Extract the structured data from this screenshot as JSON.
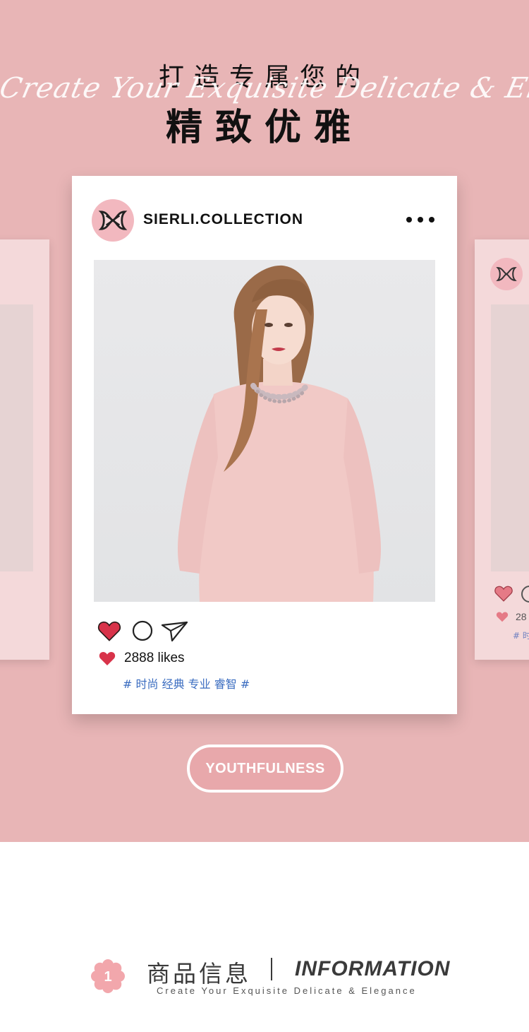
{
  "header": {
    "title_line1": "打造专属您的",
    "title_line2": "精致优雅",
    "script_text": "Create Your Exquisite Delicate & Elegance"
  },
  "post": {
    "handle": "SIERLI.COLLECTION",
    "likes_text": "2888 likes",
    "tags": "# 时尚 经典 专业 睿智 #",
    "icons": [
      "more-icon",
      "heart-icon",
      "comment-icon",
      "share-icon"
    ]
  },
  "side_card_right": {
    "likes_text": "28",
    "tags": "# 时"
  },
  "badge": {
    "label": "YOUTHFULNESS"
  },
  "info": {
    "number": "1",
    "cn": "商品信息",
    "en": "INFORMATION",
    "sub": "Create Your Exquisite Delicate & Elegance"
  },
  "colors": {
    "background_pink": "#e8b5b6",
    "card_white": "#ffffff",
    "heart_red": "#d8334a",
    "tag_blue": "#3a6cc0"
  }
}
